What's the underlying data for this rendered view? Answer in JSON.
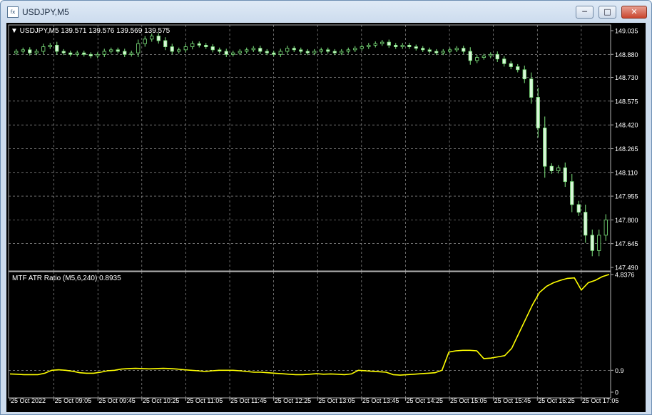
{
  "window": {
    "title": "USDJPY,M5",
    "icon": "chart-window-icon"
  },
  "controls": {
    "minimize_icon": "minimize-icon",
    "maximize_icon": "maximize-icon",
    "close_icon": "close-icon"
  },
  "colors": {
    "background": "#000000",
    "grid": "#b0b0b0",
    "bull": "#7ee67e",
    "bear": "#d9f7d9",
    "indicator": "#ffff00",
    "axis_text": "#ffffff"
  },
  "price_panel": {
    "header": "▼ USDJPY,M5  139.571 139.576 139.569 139.575"
  },
  "indicator_panel": {
    "header": "MTF ATR Ratio  (M5,6,240) 0.8935"
  },
  "chart_data": [
    {
      "type": "candlestick",
      "title": "USDJPY,M5",
      "ylim": [
        147.49,
        149.035
      ],
      "y_ticks": [
        "149.035",
        "148.880",
        "148.730",
        "148.575",
        "148.420",
        "148.265",
        "148.110",
        "147.955",
        "147.800",
        "147.645",
        "147.490"
      ],
      "x_ticks": [
        "25 Oct 2022",
        "25 Oct 09:05",
        "25 Oct 09:45",
        "25 Oct 10:25",
        "25 Oct 11:05",
        "25 Oct 11:45",
        "25 Oct 12:25",
        "25 Oct 13:05",
        "25 Oct 13:45",
        "25 Oct 14:25",
        "25 Oct 15:05",
        "25 Oct 15:45",
        "25 Oct 16:25",
        "25 Oct 17:05"
      ],
      "close_path": [
        148.9,
        148.91,
        148.89,
        148.9,
        148.93,
        148.94,
        148.9,
        148.89,
        148.88,
        148.89,
        148.88,
        148.87,
        148.88,
        148.9,
        148.91,
        148.9,
        148.88,
        148.89,
        148.95,
        148.98,
        149.0,
        148.97,
        148.93,
        148.9,
        148.91,
        148.93,
        148.95,
        148.94,
        148.93,
        148.91,
        148.9,
        148.88,
        148.89,
        148.9,
        148.91,
        148.92,
        148.9,
        148.89,
        148.88,
        148.9,
        148.92,
        148.91,
        148.9,
        148.89,
        148.9,
        148.91,
        148.9,
        148.89,
        148.9,
        148.91,
        148.92,
        148.93,
        148.94,
        148.95,
        148.96,
        148.94,
        148.93,
        148.94,
        148.93,
        148.92,
        148.91,
        148.9,
        148.89,
        148.9,
        148.91,
        148.92,
        148.9,
        148.84,
        148.86,
        148.87,
        148.88,
        148.85,
        148.82,
        148.8,
        148.78,
        148.72,
        148.6,
        148.4,
        148.15,
        148.12,
        148.14,
        148.05,
        147.9,
        147.85,
        147.7,
        147.6,
        147.7,
        147.8
      ]
    },
    {
      "type": "line",
      "title": "MTF ATR Ratio",
      "ylim": [
        0,
        4.8376
      ],
      "y_ticks": [
        "4.8376",
        "0.9",
        "0"
      ],
      "series": [
        {
          "values": [
            0.75,
            0.74,
            0.72,
            0.72,
            0.72,
            0.78,
            0.9,
            0.92,
            0.9,
            0.86,
            0.8,
            0.78,
            0.78,
            0.82,
            0.88,
            0.9,
            0.95,
            0.97,
            0.98,
            0.97,
            0.96,
            0.97,
            0.98,
            0.97,
            0.95,
            0.92,
            0.9,
            0.88,
            0.85,
            0.88,
            0.9,
            0.9,
            0.9,
            0.88,
            0.85,
            0.82,
            0.82,
            0.8,
            0.78,
            0.76,
            0.74,
            0.72,
            0.72,
            0.74,
            0.76,
            0.74,
            0.75,
            0.74,
            0.72,
            0.75,
            0.9,
            0.88,
            0.86,
            0.84,
            0.82,
            0.72,
            0.7,
            0.72,
            0.74,
            0.76,
            0.78,
            0.8,
            0.9,
            1.65,
            1.7,
            1.72,
            1.72,
            1.7,
            1.38,
            1.4,
            1.45,
            1.5,
            1.8,
            2.4,
            3.0,
            3.6,
            4.1,
            4.35,
            4.5,
            4.6,
            4.68,
            4.7,
            4.2,
            4.5,
            4.6,
            4.75,
            4.84
          ]
        }
      ]
    }
  ]
}
